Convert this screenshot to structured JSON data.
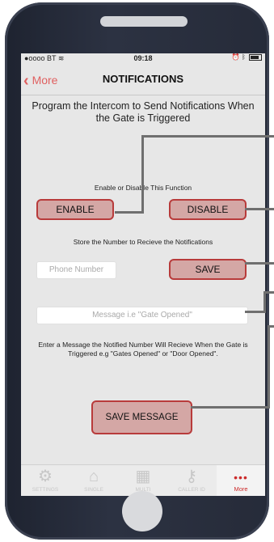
{
  "status_bar": {
    "carrier": "●oooo BT",
    "wifi": "wifi-icon",
    "time": "09:18",
    "right": "alarm-icon bluetooth-icon battery-icon"
  },
  "nav": {
    "back_label": "More",
    "title": "NOTIFICATIONS"
  },
  "heading": "Program the Intercom to Send Notifications When the Gate is Triggered",
  "enable_section": {
    "label": "Enable or Disable This Function",
    "enable_button": "ENABLE",
    "disable_button": "DISABLE"
  },
  "number_section": {
    "label": "Store the Number to Recieve the Notifications",
    "phone_placeholder": "Phone Number",
    "save_button": "SAVE"
  },
  "message_section": {
    "placeholder": "Message i.e \"Gate Opened\"",
    "helper_text": "Enter a Message the Notified Number Will Recieve When the Gate is Triggered e.g \"Gates Opened\" or \"Door Opened\".",
    "save_message_button": "SAVE MESSAGE"
  },
  "tabs": [
    {
      "label": "SETTINGS",
      "icon": "gear-icon"
    },
    {
      "label": "SINGLE",
      "icon": "house-icon"
    },
    {
      "label": "MULTI",
      "icon": "building-icon"
    },
    {
      "label": "CALLER ID",
      "icon": "key-icon"
    },
    {
      "label": "More",
      "icon": "more-dots-icon"
    }
  ],
  "colors": {
    "accent": "#cc2b2b",
    "button_fill": "#d4a7a5",
    "button_border": "#b83b3b",
    "phone_body": "#262b39"
  }
}
